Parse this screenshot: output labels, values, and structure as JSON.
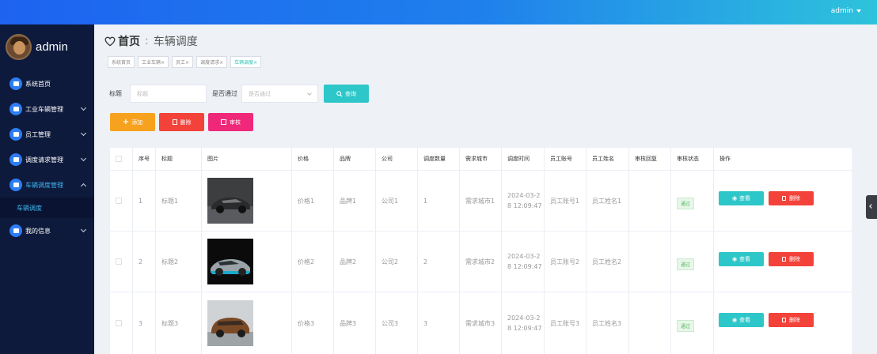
{
  "topbar": {
    "user": "admin",
    "bg_from": "#1d63f0",
    "bg_to": "#2ec3dc"
  },
  "sidebar": {
    "username": "admin",
    "items": [
      {
        "label": "系统首页",
        "icon": "home-icon"
      },
      {
        "label": "工业车辆管理",
        "icon": "car-icon"
      },
      {
        "label": "员工管理",
        "icon": "grid-icon"
      },
      {
        "label": "调度请求管理",
        "icon": "briefcase-icon"
      },
      {
        "label": "车辆调度管理",
        "icon": "apps-icon"
      },
      {
        "label": "我的信息",
        "icon": "user-card-icon"
      }
    ],
    "active_sub": "车辆调度"
  },
  "header": {
    "home": "首页",
    "current": "车辆调度"
  },
  "tags": [
    "系统首页",
    "工业车辆×",
    "员工×",
    "调度请求×",
    "车辆调度×"
  ],
  "search": {
    "title_label": "标题",
    "title_placeholder": "标题",
    "pass_label": "是否通过",
    "pass_placeholder": "是否通过",
    "query_button": "查询"
  },
  "actions": {
    "add": "添加",
    "delete": "删除",
    "audit": "审核"
  },
  "table": {
    "columns": [
      "序号",
      "标题",
      "图片",
      "价格",
      "品牌",
      "公司",
      "调度数量",
      "需求城市",
      "调度时间",
      "员工账号",
      "员工姓名",
      "审核回复",
      "审核状态",
      "操作"
    ],
    "rows": [
      {
        "no": "1",
        "title": "标题1",
        "price": "价格1",
        "brand": "品牌1",
        "company": "公司1",
        "qty": "1",
        "city": "需求城市1",
        "time": "2024-03-2\n8 12:09:47",
        "account": "员工账号1",
        "name": "员工姓名1",
        "reply": "",
        "status": "通过"
      },
      {
        "no": "2",
        "title": "标题2",
        "price": "价格2",
        "brand": "品牌2",
        "company": "公司2",
        "qty": "2",
        "city": "需求城市2",
        "time": "2024-03-2\n8 12:09:47",
        "account": "员工账号2",
        "name": "员工姓名2",
        "reply": "",
        "status": "通过"
      },
      {
        "no": "3",
        "title": "标题3",
        "price": "价格3",
        "brand": "品牌3",
        "company": "公司3",
        "qty": "3",
        "city": "需求城市3",
        "time": "2024-03-2\n8 12:09:47",
        "account": "员工账号3",
        "name": "员工姓名3",
        "reply": "",
        "status": "通过"
      }
    ],
    "view_label": "查看",
    "delete_label": "删除"
  },
  "colors": {
    "teal": "#2ec7c9",
    "orange": "#f7a21e",
    "red": "#f3423a",
    "pink": "#f0287a",
    "sidebar": "#0e1a3c"
  }
}
